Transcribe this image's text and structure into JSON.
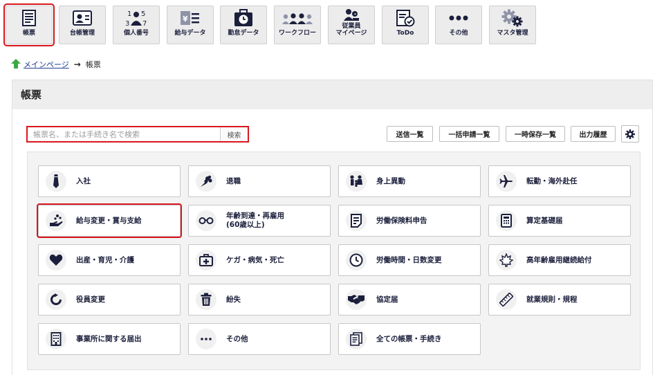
{
  "nav": {
    "items": [
      {
        "label": "帳票",
        "icon": "document-list-icon"
      },
      {
        "label": "台帳管理",
        "icon": "id-card-icon"
      },
      {
        "label": "個人番号",
        "icon": "personal-number-icon"
      },
      {
        "label": "給与データ",
        "icon": "salary-data-icon"
      },
      {
        "label": "勤怠データ",
        "icon": "attendance-clock-icon"
      },
      {
        "label": "ワークフロー",
        "icon": "workflow-people-icon"
      },
      {
        "label": "従業員\nマイページ",
        "icon": "employee-mypage-icon"
      },
      {
        "label": "ToDo",
        "icon": "todo-check-icon"
      },
      {
        "label": "その他",
        "icon": "more-dots-icon"
      },
      {
        "label": "マスタ管理",
        "icon": "gears-icon"
      }
    ],
    "active_index": 0
  },
  "breadcrumb": {
    "home_link": "メインページ",
    "separator": "→",
    "current": "帳票"
  },
  "page": {
    "title": "帳票"
  },
  "search": {
    "placeholder": "帳票名、または手続き名で検索",
    "button": "検索"
  },
  "actions": {
    "sent_list": "送信一覧",
    "bulk_list": "一括申請一覧",
    "temp_saved": "一時保存一覧",
    "output_history": "出力履歴"
  },
  "tiles": [
    {
      "label": "入社",
      "icon": "necktie-icon"
    },
    {
      "label": "退職",
      "icon": "bouquet-icon"
    },
    {
      "label": "身上異動",
      "icon": "family-icon"
    },
    {
      "label": "転勤・海外赴任",
      "icon": "airplane-icon"
    },
    {
      "label": "給与変更・賞与支給",
      "icon": "money-hand-icon",
      "highlighted": true
    },
    {
      "label": "年齢到達・再雇用\n(60歳以上)",
      "icon": "glasses-icon"
    },
    {
      "label": "労働保険料申告",
      "icon": "form-icon"
    },
    {
      "label": "算定基礎届",
      "icon": "calculator-icon"
    },
    {
      "label": "出産・育児・介護",
      "icon": "heart-icon"
    },
    {
      "label": "ケガ・病気・死亡",
      "icon": "first-aid-icon"
    },
    {
      "label": "労働時間・日数変更",
      "icon": "clock-icon"
    },
    {
      "label": "高年齢雇用継続給付",
      "icon": "maple-leaf-icon"
    },
    {
      "label": "役員変更",
      "icon": "refresh-icon"
    },
    {
      "label": "紛失",
      "icon": "trash-icon"
    },
    {
      "label": "協定届",
      "icon": "handshake-icon"
    },
    {
      "label": "就業規則・規程",
      "icon": "ruler-icon"
    },
    {
      "label": "事業所に関する届出",
      "icon": "building-icon"
    },
    {
      "label": "その他",
      "icon": "ellipsis-icon"
    },
    {
      "label": "全ての帳票・手続き",
      "icon": "documents-icon"
    }
  ],
  "colors": {
    "accent_red": "#d9151c",
    "navy": "#1b1f3b",
    "link_blue": "#1f3b8f",
    "home_green": "#3aa845"
  }
}
